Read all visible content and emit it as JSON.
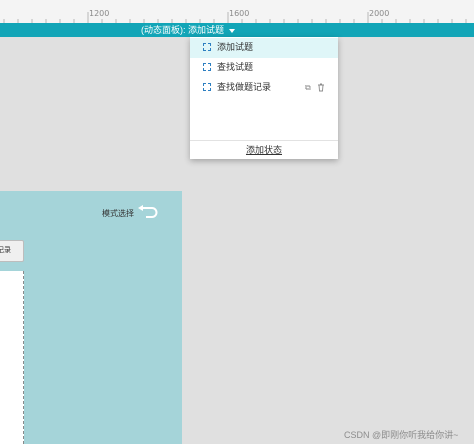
{
  "ruler": {
    "marks": [
      "1200",
      "1600",
      "2000"
    ]
  },
  "state_bar": {
    "label": "(动态面板): 添加试题"
  },
  "dropdown": {
    "items": [
      {
        "label": "添加试题",
        "active": true
      },
      {
        "label": "查找试题",
        "active": false
      },
      {
        "label": "查找做题记录",
        "active": false,
        "icons": [
          "copy-icon",
          "trash-icon"
        ]
      }
    ],
    "add_state_label": "添加状态"
  },
  "panel": {
    "mode_label": "模式选择",
    "record_button_label": "记录",
    "background_color": "#a5d4d9"
  },
  "colors": {
    "accent": "#12a5b7",
    "active_item": "#dff6f8"
  },
  "watermark": "CSDN @即刚你听我给你讲~"
}
